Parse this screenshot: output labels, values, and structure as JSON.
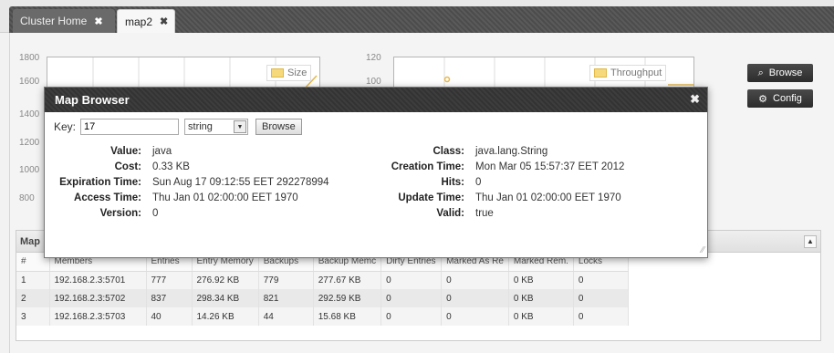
{
  "tabs": [
    {
      "label": "Cluster Home",
      "close": "✖"
    },
    {
      "label": "map2",
      "close": "✖"
    }
  ],
  "charts": {
    "size": {
      "ticks": [
        "1800",
        "1600",
        "1400",
        "1200",
        "1000",
        "800"
      ],
      "legend": "Size"
    },
    "throughput": {
      "ticks": [
        "120",
        "100"
      ],
      "legend": "Throughput"
    }
  },
  "buttons": {
    "browse": "Browse",
    "config": "Config"
  },
  "table": {
    "title": "Map",
    "collapse_icon": "▲",
    "columns": [
      "#",
      "Members",
      "Entries",
      "Entry Memory",
      "Backups",
      "Backup Memc",
      "Dirty Entries",
      "Marked As Re",
      "Marked Rem.",
      "Locks"
    ],
    "rows": [
      [
        "1",
        "192.168.2.3:5701",
        "777",
        "276.92 KB",
        "779",
        "277.67 KB",
        "0",
        "0",
        "0 KB",
        "0"
      ],
      [
        "2",
        "192.168.2.3:5702",
        "837",
        "298.34 KB",
        "821",
        "292.59 KB",
        "0",
        "0",
        "0 KB",
        "0"
      ],
      [
        "3",
        "192.168.2.3:5703",
        "40",
        "14.26 KB",
        "44",
        "15.68 KB",
        "0",
        "0",
        "0 KB",
        "0"
      ]
    ]
  },
  "dialog": {
    "title": "Map Browser",
    "close": "✖",
    "key_label": "Key:",
    "key_value": "17",
    "type_value": "string",
    "browse_label": "Browse",
    "left": [
      {
        "label": "Value:",
        "value": "java"
      },
      {
        "label": "Cost:",
        "value": "0.33 KB"
      },
      {
        "label": "Expiration Time:",
        "value": "Sun Aug 17 09:12:55 EET 292278994"
      },
      {
        "label": "Access Time:",
        "value": "Thu Jan 01 02:00:00 EET 1970"
      },
      {
        "label": "Version:",
        "value": "0"
      }
    ],
    "right": [
      {
        "label": "Class:",
        "value": "java.lang.String"
      },
      {
        "label": "Creation Time:",
        "value": "Mon Mar 05 15:57:37 EET 2012"
      },
      {
        "label": "Hits:",
        "value": "0"
      },
      {
        "label": "Update Time:",
        "value": "Thu Jan 01 02:00:00 EET 1970"
      },
      {
        "label": "Valid:",
        "value": "true"
      }
    ]
  }
}
